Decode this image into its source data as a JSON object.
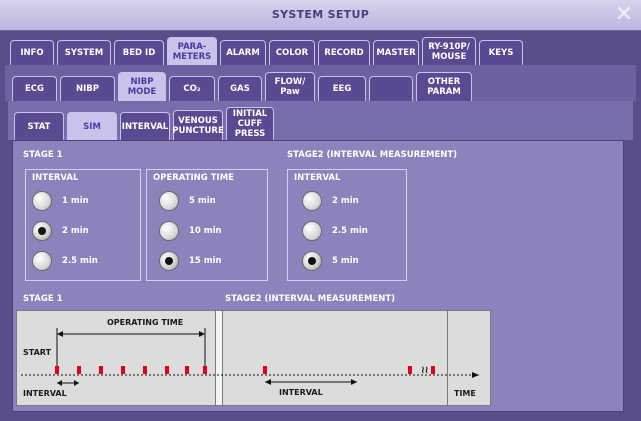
{
  "window": {
    "title": "SYSTEM SETUP",
    "close_label": "✕"
  },
  "tabs_row1": [
    "INFO",
    "SYSTEM",
    "BED ID",
    "PARA-\nMETERS",
    "ALARM",
    "COLOR",
    "RECORD",
    "MASTER",
    "RY-910P/\nMOUSE",
    "KEYS"
  ],
  "tabs_row2": [
    "ECG",
    "NIBP",
    "NIBP\nMODE",
    "CO₂",
    "GAS",
    "FLOW/\nPaw",
    "EEG",
    "",
    "OTHER\nPARAM"
  ],
  "tabs_row3": [
    "STAT",
    "SIM",
    "INTERVAL",
    "VENOUS\nPUNCTURE",
    "INITIAL\nCUFF\nPRESS"
  ],
  "stage1": {
    "title": "STAGE 1",
    "interval": {
      "title": "INTERVAL",
      "options": [
        "1 min",
        "2 min",
        "2.5 min"
      ],
      "selected": 1
    },
    "operating_time": {
      "title": "OPERATING TIME",
      "options": [
        "5 min",
        "10 min",
        "15 min"
      ],
      "selected": 2
    }
  },
  "stage2": {
    "title": "STAGE2 (INTERVAL MEASUREMENT)",
    "interval": {
      "title": "INTERVAL",
      "options": [
        "2 min",
        "2.5 min",
        "5 min"
      ],
      "selected": 2
    }
  },
  "diagram": {
    "stage1_label": "STAGE 1",
    "stage2_label": "STAGE2 (INTERVAL MEASUREMENT)",
    "operating_time": "OPERATING TIME",
    "start": "START",
    "interval_a": "INTERVAL",
    "interval_b": "INTERVAL",
    "time": "TIME",
    "break_mark": "≀≀"
  }
}
